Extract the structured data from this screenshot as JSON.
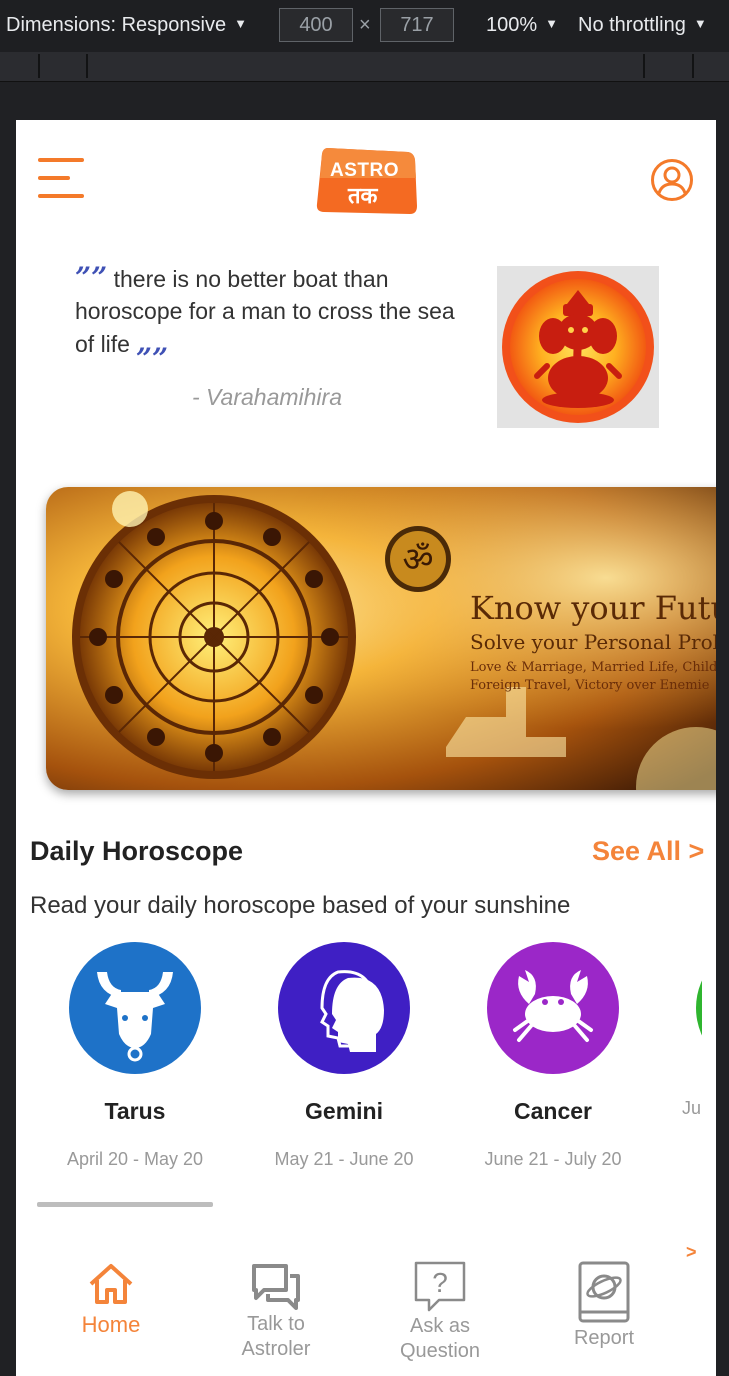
{
  "devtools": {
    "dimensions_label": "Dimensions: Responsive",
    "width": "400",
    "height": "717",
    "times": "×",
    "zoom": "100%",
    "throttling": "No throttling"
  },
  "header": {
    "logo_top": "ASTRO",
    "logo_bottom": "तक"
  },
  "quote": {
    "open_mark": "””",
    "text": "there is no better boat than horoscope for a man to cross the sea of life",
    "close_mark": "„„",
    "author": "- Varahamihira"
  },
  "banner": {
    "headline": "Know your Futu",
    "subline": "Solve your Personal Proble",
    "small_line1": "Love & Marriage, Married Life, Child",
    "small_line2": "Foreign Travel, Victory over Enemie"
  },
  "daily": {
    "title": "Daily Horoscope",
    "see_all": "See All >",
    "description": "Read your daily horoscope based of your sunshine",
    "signs": [
      {
        "name": "Tarus",
        "dates": "April 20 - May 20",
        "color": "#1e72c8",
        "icon": "taurus-bull-icon"
      },
      {
        "name": "Gemini",
        "dates": "May 21 - June 20",
        "color": "#3f1fc4",
        "icon": "gemini-heads-icon"
      },
      {
        "name": "Cancer",
        "dates": "June 21 - July 20",
        "color": "#9b27c8",
        "icon": "cancer-crab-icon"
      },
      {
        "name": "",
        "dates": "Ju",
        "color": "#2fb52f",
        "icon": "leo-icon"
      }
    ],
    "more_arrow": ">"
  },
  "nav": {
    "items": [
      {
        "label": "Home",
        "icon": "home-icon",
        "active": true
      },
      {
        "label_line1": "Talk to",
        "label_line2": "Astroler",
        "icon": "chat-icon"
      },
      {
        "label_line1": "Ask as",
        "label_line2": "Question",
        "icon": "question-icon"
      },
      {
        "label": "Report",
        "icon": "report-book-icon"
      }
    ]
  },
  "colors": {
    "accent": "#f4843a",
    "quote_marks": "#3f51b5"
  }
}
